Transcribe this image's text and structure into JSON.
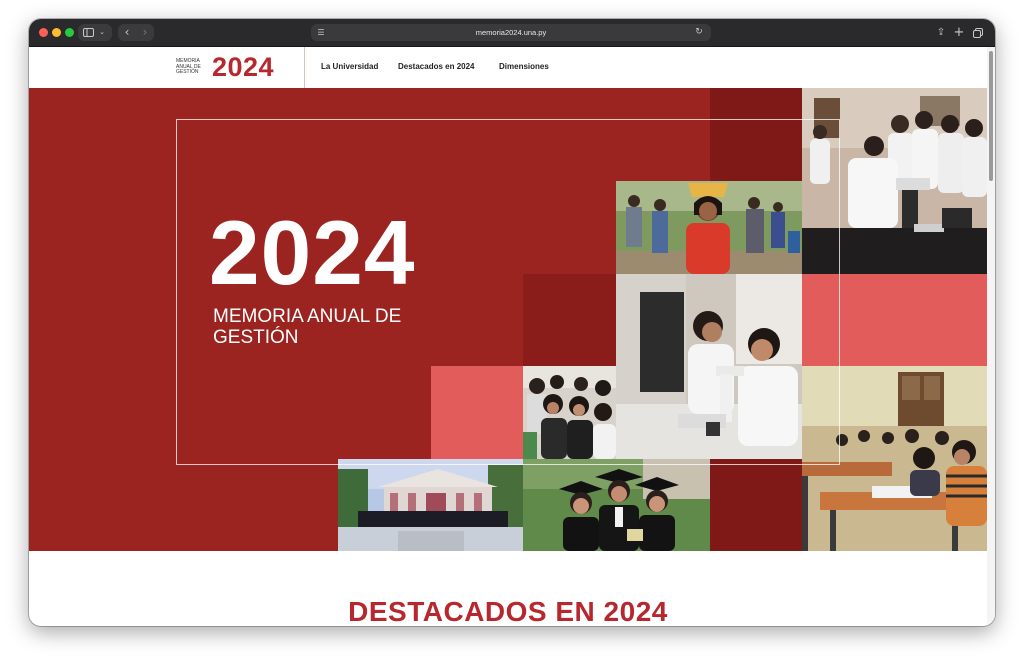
{
  "browser": {
    "url": "memoria2024.una.py",
    "icons": [
      "sidebar-icon",
      "chevron-down-icon",
      "back-icon",
      "forward-icon",
      "page-menu-icon",
      "reload-icon",
      "share-icon",
      "new-tab-icon",
      "tab-overview-icon"
    ]
  },
  "site": {
    "logo_small": "MEMORIA ANUAL DE GESTIÓN",
    "logo_year": "2024",
    "nav": [
      "La Universidad",
      "Destacados en 2024",
      "Dimensiones"
    ]
  },
  "hero": {
    "year": "2024",
    "subtitle": "MEMORIA ANUAL DE GESTIÓN"
  },
  "section": {
    "title": "DESTACADOS EN 2024"
  },
  "colors": {
    "brand_red": "#b7282e",
    "hero_red": "#9b2420",
    "dark_red": "#7f1917",
    "coral": "#e25c5c"
  }
}
